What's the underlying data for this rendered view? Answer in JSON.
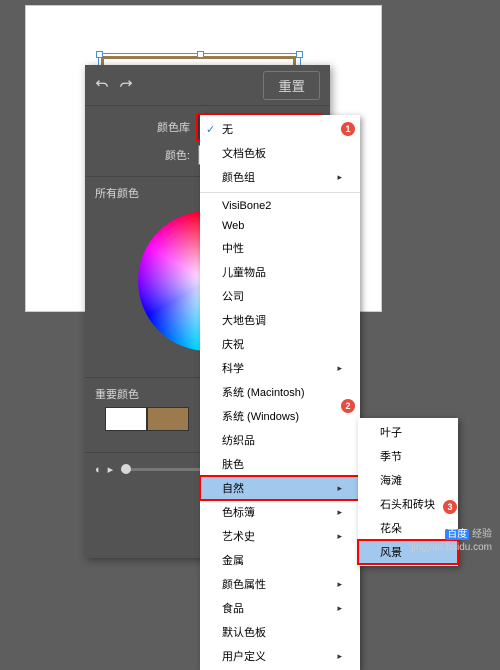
{
  "panel": {
    "reset": "重置",
    "color_lib_label": "颜色库",
    "color_lib_value": "无",
    "color_label": "颜色:",
    "all_colors": "所有颜色",
    "important_colors": "重要颜色",
    "opacity_value": "0"
  },
  "menu1": {
    "items": [
      {
        "label": "无",
        "check": true
      },
      {
        "label": "文档色板"
      },
      {
        "label": "颜色组",
        "sub": true
      },
      {
        "sep": true
      },
      {
        "label": "VisiBone2"
      },
      {
        "label": "Web"
      },
      {
        "label": "中性"
      },
      {
        "label": "儿童物品"
      },
      {
        "label": "公司"
      },
      {
        "label": "大地色调"
      },
      {
        "label": "庆祝"
      },
      {
        "label": "科学",
        "sub": true
      },
      {
        "label": "系统 (Macintosh)"
      },
      {
        "label": "系统 (Windows)"
      },
      {
        "label": "纺织品"
      },
      {
        "label": "肤色"
      },
      {
        "label": "自然",
        "sub": true,
        "hl": true
      },
      {
        "label": "色标簿",
        "sub": true
      },
      {
        "label": "艺术史",
        "sub": true
      },
      {
        "label": "金属"
      },
      {
        "label": "颜色属性",
        "sub": true
      },
      {
        "label": "食品",
        "sub": true
      },
      {
        "label": "默认色板"
      },
      {
        "label": "用户定义",
        "sub": true
      }
    ]
  },
  "menu2": {
    "items": [
      {
        "label": "叶子"
      },
      {
        "label": "季节"
      },
      {
        "label": "海滩"
      },
      {
        "label": "石头和砖块"
      },
      {
        "label": "花朵"
      },
      {
        "label": "风景",
        "hl": true
      }
    ]
  },
  "badges": {
    "b1": "1",
    "b2": "2",
    "b3": "3"
  },
  "watermark": {
    "brand": "Bai",
    "brand2": "百度",
    "sub": "经验",
    "url": "jingyan.baidu.com"
  }
}
